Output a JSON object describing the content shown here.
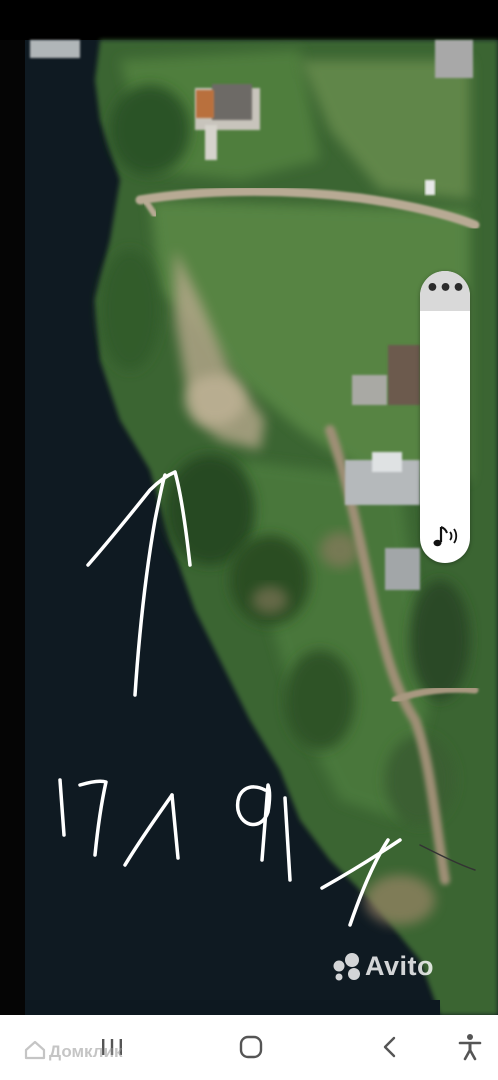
{
  "map": {
    "annotation_text": "17 1 91",
    "annotation_mark": "x",
    "arrow": "arrow-up-icon"
  },
  "side_panel": {
    "menu_icon": "more-dots-icon",
    "menu_glyph": "•••",
    "sound_icon": "music-sound-icon"
  },
  "watermarks": {
    "avito": "Avito",
    "domclick": "Домклик"
  },
  "nav_bar": {
    "recents_icon": "recents-icon",
    "home_icon": "home-icon",
    "back_icon": "back-icon",
    "accessibility_icon": "accessibility-icon"
  },
  "colors": {
    "water": "#0f1a22",
    "vegetation": "#3e6a35",
    "road": "#b8aa94",
    "nav_background": "#ffffff",
    "panel_handle": "#d9d9d9"
  }
}
